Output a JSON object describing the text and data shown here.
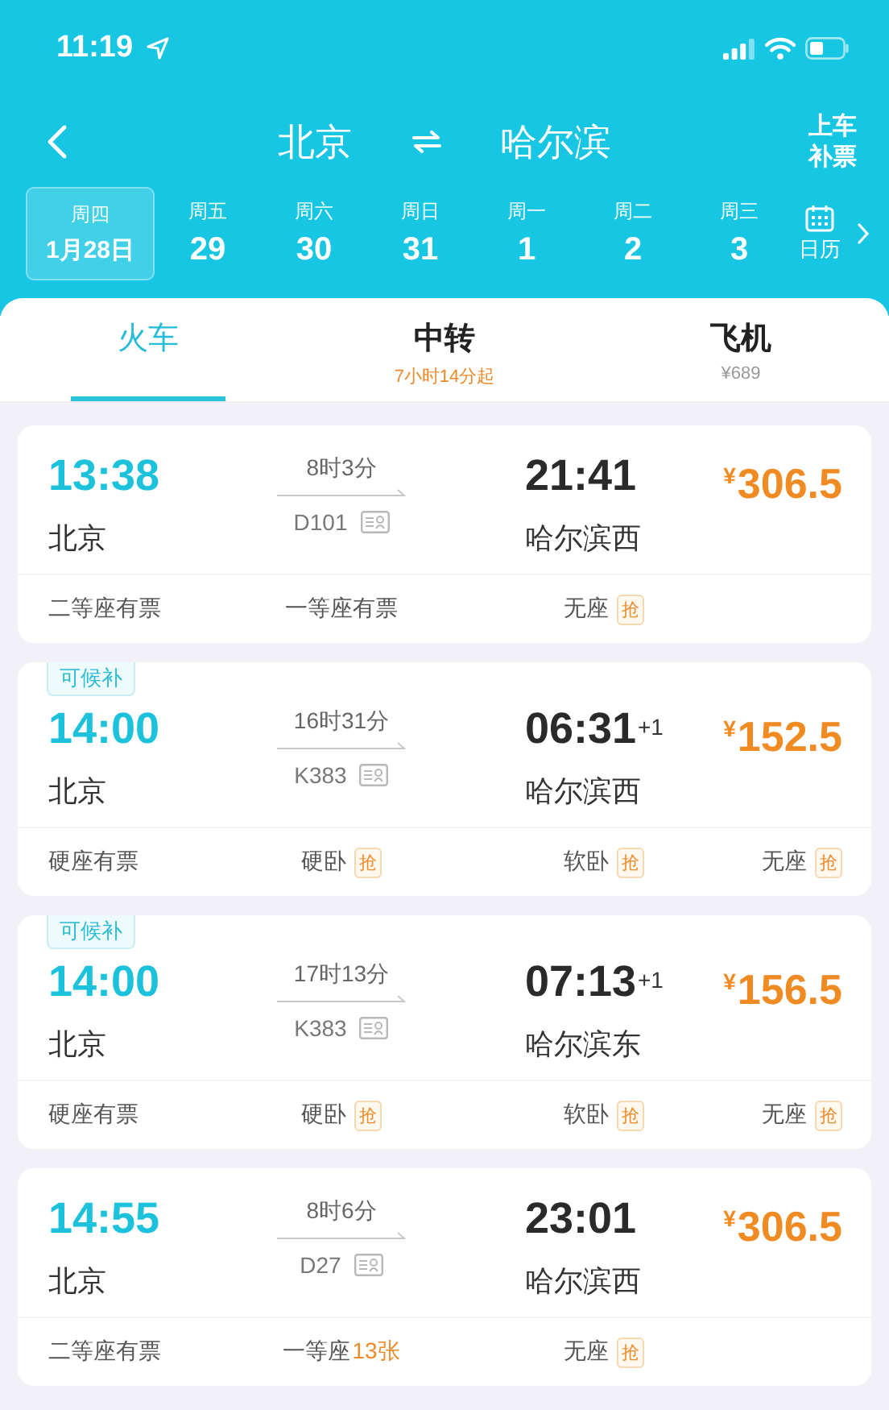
{
  "status_bar": {
    "time": "11:19"
  },
  "header": {
    "from": "北京",
    "to": "哈尔滨",
    "side_button": [
      "上车",
      "补票"
    ]
  },
  "dates": [
    {
      "weekday": "周四",
      "date": "1月28日",
      "selected": true
    },
    {
      "weekday": "周五",
      "date": "29",
      "selected": false
    },
    {
      "weekday": "周六",
      "date": "30",
      "selected": false
    },
    {
      "weekday": "周日",
      "date": "31",
      "selected": false
    },
    {
      "weekday": "周一",
      "date": "1",
      "selected": false
    },
    {
      "weekday": "周二",
      "date": "2",
      "selected": false
    },
    {
      "weekday": "周三",
      "date": "3",
      "selected": false
    }
  ],
  "calendar": {
    "label": "日历"
  },
  "tabs": [
    {
      "label": "火车",
      "selected": true
    },
    {
      "label": "中转",
      "note": "7小时14分起",
      "kind": "highlight",
      "selected": false
    },
    {
      "label": "飞机",
      "note": "¥689",
      "kind": "plain",
      "selected": false
    }
  ],
  "trains": [
    {
      "depart": "13:38",
      "from": "北京",
      "duration": "8时3分",
      "number": "D101",
      "arrive": "21:41",
      "to": "哈尔滨西",
      "currency": "¥",
      "price": "306.5",
      "seats": [
        {
          "label": "二等座有票"
        },
        {
          "label": "一等座有票"
        },
        {
          "label": "无座",
          "badge": "抢"
        }
      ]
    },
    {
      "waitlist": "可候补",
      "depart": "14:00",
      "from": "北京",
      "duration": "16时31分",
      "number": "K383",
      "arrive": "06:31",
      "day_offset": "+1",
      "to": "哈尔滨西",
      "currency": "¥",
      "price": "152.5",
      "seats": [
        {
          "label": "硬座有票"
        },
        {
          "label": "硬卧",
          "badge": "抢"
        },
        {
          "label": "软卧",
          "badge": "抢"
        },
        {
          "label": "无座",
          "badge": "抢"
        }
      ]
    },
    {
      "waitlist": "可候补",
      "depart": "14:00",
      "from": "北京",
      "duration": "17时13分",
      "number": "K383",
      "arrive": "07:13",
      "day_offset": "+1",
      "to": "哈尔滨东",
      "currency": "¥",
      "price": "156.5",
      "seats": [
        {
          "label": "硬座有票"
        },
        {
          "label": "硬卧",
          "badge": "抢"
        },
        {
          "label": "软卧",
          "badge": "抢"
        },
        {
          "label": "无座",
          "badge": "抢"
        }
      ]
    },
    {
      "depart": "14:55",
      "from": "北京",
      "duration": "8时6分",
      "number": "D27",
      "arrive": "23:01",
      "to": "哈尔滨西",
      "currency": "¥",
      "price": "306.5",
      "seats": [
        {
          "label": "二等座有票"
        },
        {
          "label": "一等座",
          "count": "13张"
        },
        {
          "label": "无座",
          "badge": "抢"
        }
      ]
    }
  ]
}
